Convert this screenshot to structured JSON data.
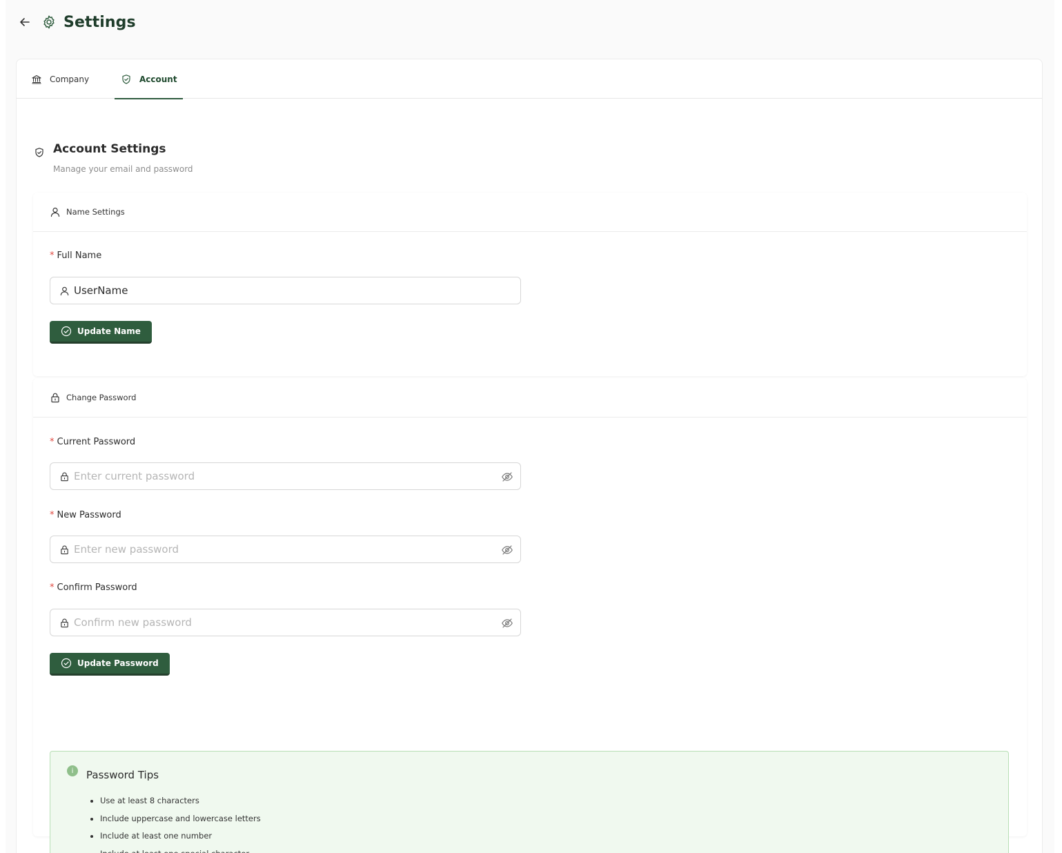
{
  "header": {
    "title": "Settings"
  },
  "tabs": [
    {
      "label": "Company",
      "active": false
    },
    {
      "label": "Account",
      "active": true
    }
  ],
  "section": {
    "title": "Account Settings",
    "subtitle": "Manage your email and password"
  },
  "name_panel": {
    "title": "Name Settings",
    "full_name_label": "Full Name",
    "full_name_value": "UserName",
    "button_label": "Update Name"
  },
  "password_panel": {
    "title": "Change Password",
    "current_label": "Current Password",
    "current_placeholder": "Enter current password",
    "new_label": "New Password",
    "new_placeholder": "Enter new password",
    "confirm_label": "Confirm Password",
    "confirm_placeholder": "Confirm new password",
    "button_label": "Update Password"
  },
  "tips": {
    "title": "Password Tips",
    "items": [
      "Use at least 8 characters",
      "Include uppercase and lowercase letters",
      "Include at least one number",
      "Include at least one special character"
    ]
  },
  "colors": {
    "accent": "#2f5d3e",
    "required": "#e0473f",
    "tips_bg": "#f0f9ef",
    "tips_border": "#b7dfb4"
  },
  "required_mark": "*"
}
